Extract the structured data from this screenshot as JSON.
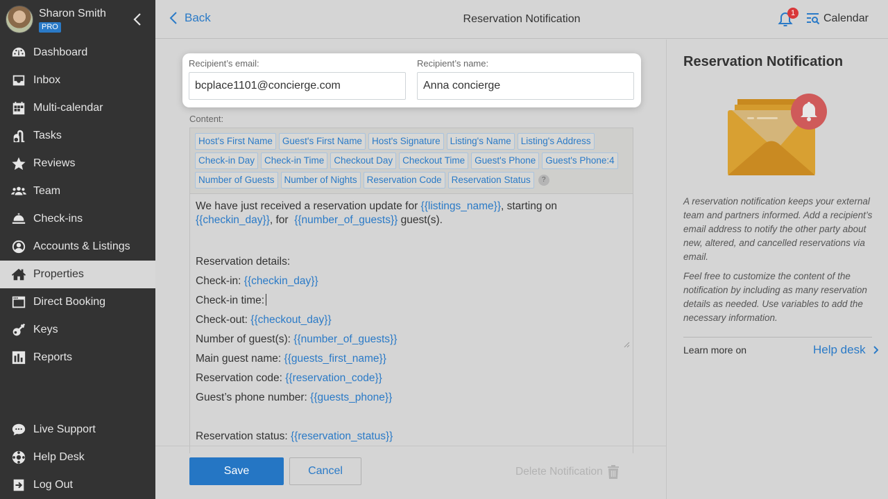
{
  "user": {
    "name": "Sharon Smith",
    "badge": "PRO"
  },
  "sidebar": {
    "items": [
      {
        "label": "Dashboard",
        "icon": "dashboard-icon"
      },
      {
        "label": "Inbox",
        "icon": "inbox-icon"
      },
      {
        "label": "Multi-calendar",
        "icon": "calendar-icon"
      },
      {
        "label": "Tasks",
        "icon": "vacuum-icon"
      },
      {
        "label": "Reviews",
        "icon": "star-icon"
      },
      {
        "label": "Team",
        "icon": "team-icon"
      },
      {
        "label": "Check-ins",
        "icon": "service-bell-icon"
      },
      {
        "label": "Accounts & Listings",
        "icon": "user-circle-icon"
      },
      {
        "label": "Properties",
        "icon": "home-icon",
        "active": true
      },
      {
        "label": "Direct Booking",
        "icon": "code-window-icon"
      },
      {
        "label": "Keys",
        "icon": "key-icon"
      },
      {
        "label": "Reports",
        "icon": "bar-chart-icon"
      }
    ],
    "bottom_items": [
      {
        "label": "Live Support",
        "icon": "chat-icon"
      },
      {
        "label": "Help Desk",
        "icon": "lifebuoy-icon"
      },
      {
        "label": "Log Out",
        "icon": "logout-icon"
      }
    ]
  },
  "header": {
    "back_label": "Back",
    "title": "Reservation Notification",
    "notification_count": "1",
    "calendar_label": "Calendar"
  },
  "form": {
    "email_label": "Recipient’s email:",
    "email_value": "bcplace1101@concierge.com",
    "name_label": "Recipient’s name:",
    "name_value": "Anna concierge",
    "content_label": "Content:",
    "variables": [
      [
        "Host's First Name",
        "Guest's First Name",
        "Host's Signature",
        "Listing's Name",
        "Listing's Address"
      ],
      [
        "Check-in Day",
        "Check-in Time",
        "Checkout Day",
        "Checkout Time",
        "Guest's Phone",
        "Guest's Phone:4"
      ],
      [
        "Number of Guests",
        "Number of Nights",
        "Reservation Code",
        "Reservation Status"
      ]
    ],
    "help_label": "?",
    "body": {
      "intro_1": "We have just received a reservation update for ",
      "intro_var_1": "{{listings_name}}",
      "intro_2": ", starting on",
      "intro_var_2": "{{checkin_day}}",
      "intro_3": ", for  ",
      "intro_var_3": "{{number_of_guests}}",
      "intro_4": " guest(s).",
      "details_heading": "Reservation details:",
      "details": [
        {
          "label": "Check-in: ",
          "var": "{{checkin_day}}"
        },
        {
          "label": "Check-in time:",
          "var": ""
        },
        {
          "label": "Check-out: ",
          "var": "{{checkout_day}}"
        },
        {
          "label": "Number of guest(s): ",
          "var": "{{number_of_guests}}"
        },
        {
          "label": "Main guest name: ",
          "var": "{{guests_first_name}}"
        },
        {
          "label": "Reservation code: ",
          "var": "{{reservation_code}}"
        },
        {
          "label": "Guest’s phone number: ",
          "var": "{{guests_phone}}"
        }
      ],
      "status_label": "Reservation status: ",
      "status_var": "{{reservation_status}}"
    }
  },
  "footer": {
    "save_label": "Save",
    "cancel_label": "Cancel",
    "delete_label": "Delete Notification"
  },
  "panel": {
    "title": "Reservation Notification",
    "paragraph_1": "A reservation notification keeps your external team and partners informed. Add a recipient’s email address to notify the other party about new, altered, and cancelled reservations via email.",
    "paragraph_2": "Feel free to customize the content of the notification by including as many reservation details as needed. Use variables to add the necessary information.",
    "learn_more": "Learn more on",
    "help_link": "Help desk"
  },
  "colors": {
    "accent": "#2a7ac7",
    "sidebar_bg": "#333333",
    "badge_red": "#d9383a",
    "envelope": "#d8a032"
  }
}
